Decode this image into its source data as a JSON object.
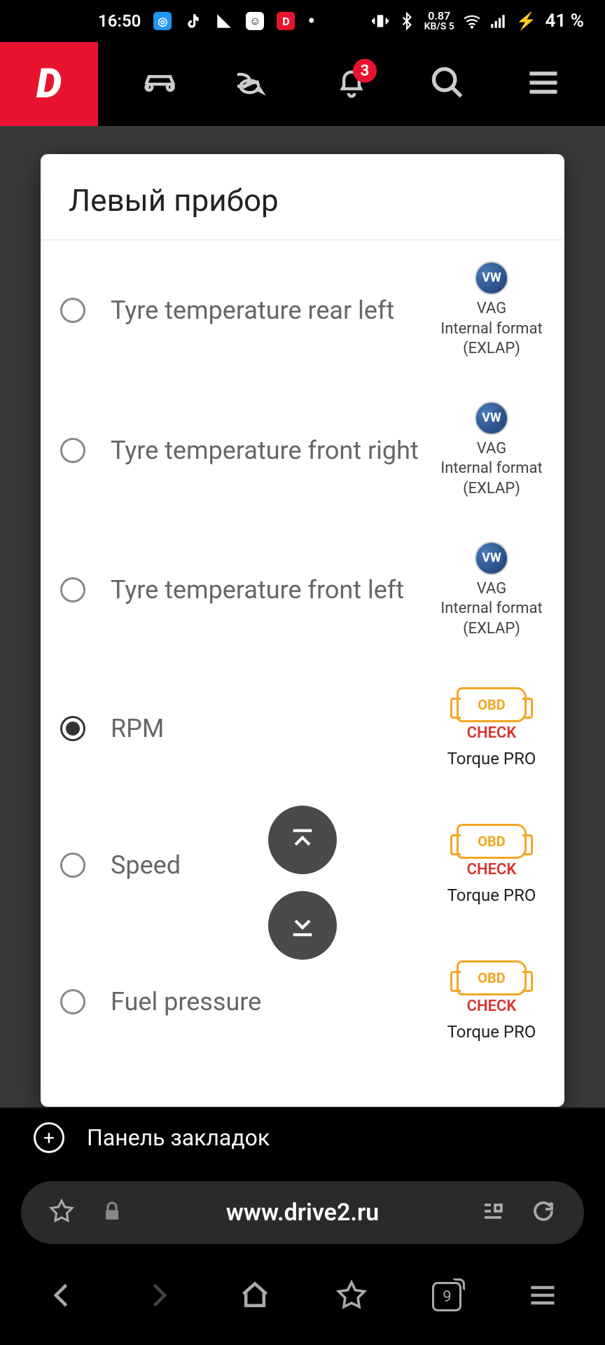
{
  "status": {
    "time": "16:50",
    "net_speed": "0.87",
    "net_unit": "KB/S",
    "net_band": "5",
    "battery": "41 %"
  },
  "header": {
    "brand": "D",
    "badge": "3"
  },
  "modal": {
    "title": "Левый прибор",
    "options": [
      {
        "label": "Tyre temperature rear left",
        "selected": false,
        "source": "vag",
        "src_line1": "VAG",
        "src_line2": "Internal format",
        "src_line3": "(EXLAP)"
      },
      {
        "label": "Tyre temperature front right",
        "selected": false,
        "source": "vag",
        "src_line1": "VAG",
        "src_line2": "Internal format",
        "src_line3": "(EXLAP)"
      },
      {
        "label": "Tyre temperature front left",
        "selected": false,
        "source": "vag",
        "src_line1": "VAG",
        "src_line2": "Internal format",
        "src_line3": "(EXLAP)"
      },
      {
        "label": "RPM",
        "selected": true,
        "source": "obd",
        "obd_text": "OBD",
        "check_text": "CHECK",
        "name_text": "Torque PRO"
      },
      {
        "label": "Speed",
        "selected": false,
        "source": "obd",
        "obd_text": "OBD",
        "check_text": "CHECK",
        "name_text": "Torque PRO"
      },
      {
        "label": "Fuel pressure",
        "selected": false,
        "source": "obd",
        "obd_text": "OBD",
        "check_text": "CHECK",
        "name_text": "Torque PRO"
      }
    ]
  },
  "bookmark": {
    "label": "Панель закладок"
  },
  "url": {
    "text": "www.drive2.ru"
  },
  "browser": {
    "tab_count": "9"
  }
}
